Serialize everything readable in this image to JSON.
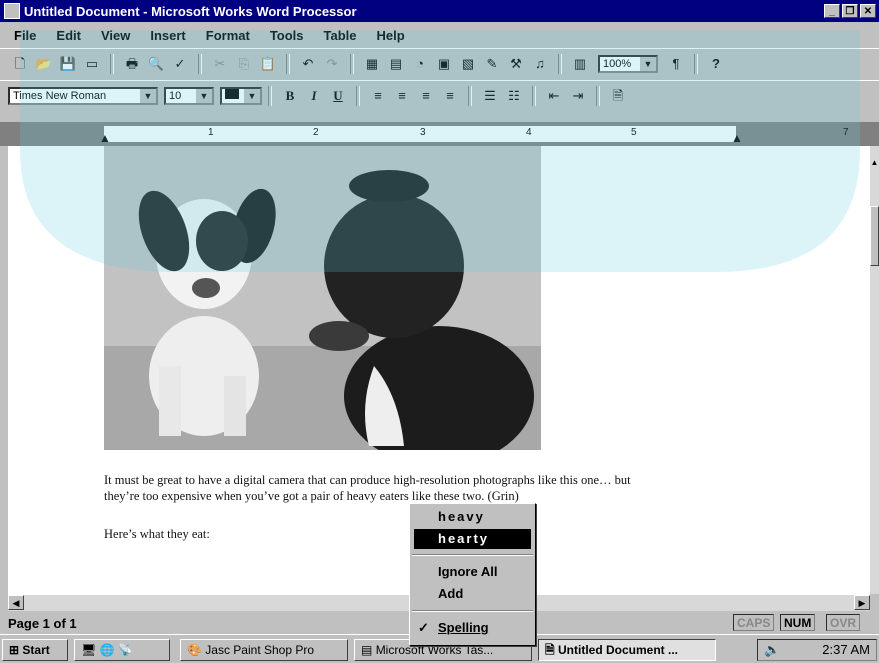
{
  "window": {
    "title": "Untitled Document - Microsoft Works Word Processor"
  },
  "menu": [
    "File",
    "Edit",
    "View",
    "Insert",
    "Format",
    "Tools",
    "Table",
    "Help"
  ],
  "toolbar": {
    "zoom": "100%",
    "font_name": "Times New Roman",
    "font_size": "10",
    "bold": "B",
    "italic": "I",
    "underline": "U",
    "paragraph_mark": "¶",
    "help": "?"
  },
  "ruler": {
    "numbers": [
      "1",
      "2",
      "3",
      "4",
      "5",
      "7"
    ]
  },
  "document": {
    "para1_line1": "It must be great to have a digital camera that can produce high-resolution photographs like this one… but",
    "para1_line2": "they’re too expensive when you’ve got a pair of heavy eaters like these two. (Grin)",
    "para2": "Here’s what they eat:"
  },
  "context_menu": {
    "suggestion1": "heavy",
    "suggestion2": "hearty",
    "ignore_all": "Ignore All",
    "add": "Add",
    "spelling": "Spelling"
  },
  "status": {
    "page": "Page 1 of 1",
    "caps": "CAPS",
    "num": "NUM",
    "ovr": "OVR"
  },
  "taskbar": {
    "start": "Start",
    "task1": "Jasc Paint Shop Pro",
    "task2": "Microsoft Works Tas...",
    "task3": "Untitled Document ...",
    "clock": "2:37 AM"
  }
}
